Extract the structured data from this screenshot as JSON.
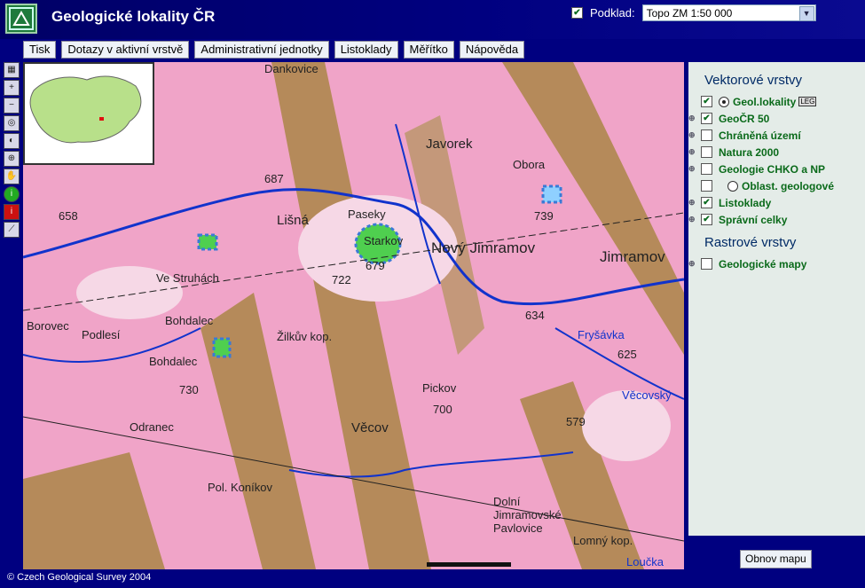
{
  "header": {
    "title": "Geologické lokality ČR",
    "podklad_label": "Podklad:",
    "podklad_checked": true,
    "podklad_value": "Topo ZM 1:50 000"
  },
  "menu": [
    "Tisk",
    "Dotazy v aktivní vrstvě",
    "Administrativní jednotky",
    "Listoklady",
    "Měřítko",
    "Nápověda"
  ],
  "tools": [
    "legend-icon",
    "zoom-in-icon",
    "zoom-out-icon",
    "zoom-extent-icon",
    "zoom-previous-icon",
    "zoom-window-icon",
    "pan-hand-icon",
    "info-green-icon",
    "info-red-icon",
    "measure-ruler-icon"
  ],
  "map": {
    "labels": [
      "Dankovice",
      "Javorek",
      "Obora",
      "Lišná",
      "Paseky",
      "Starkov",
      "679",
      "Nový Jimramov",
      "Jimramov",
      "Bohdalec",
      "Žilkův kop.",
      "Pickov",
      "700",
      "Věcov",
      "Ve Struhách",
      "Fryšávka",
      "Věcovský",
      "Borovec",
      "Podlesí",
      "Pol. Koníkov",
      "Odranec",
      "Dolní Jimramovské Pavlovice",
      "Lomný kop.",
      "Loučka",
      "Bohdalec",
      "730",
      "722",
      "658",
      "634",
      "625",
      "579",
      "739",
      "687"
    ]
  },
  "panel": {
    "vector_title": "Vektorové vrstvy",
    "raster_title": "Rastrové vrstvy",
    "layers": [
      {
        "label": "Geol.lokality",
        "checked": true,
        "radio": true,
        "legend": "LEG"
      },
      {
        "label": "GeoČR 50",
        "checked": true
      },
      {
        "label": "Chráněná území",
        "checked": false
      },
      {
        "label": "Natura 2000",
        "checked": false
      },
      {
        "label": "Geologie CHKO a NP",
        "checked": false
      },
      {
        "label": "Oblast. geologové",
        "checked": false,
        "radio": true
      },
      {
        "label": "Listoklady",
        "checked": true
      },
      {
        "label": "Správní celky",
        "checked": true
      }
    ],
    "raster_layers": [
      {
        "label": "Geologické mapy",
        "checked": false
      }
    ],
    "refresh_label": "Obnov mapu"
  },
  "footer": "© Czech Geological Survey 2004",
  "colors": {
    "background": "#000080",
    "map_pink": "#f0a4c8",
    "map_brown": "#b58a5a",
    "layer_text": "#0a6a1a"
  }
}
